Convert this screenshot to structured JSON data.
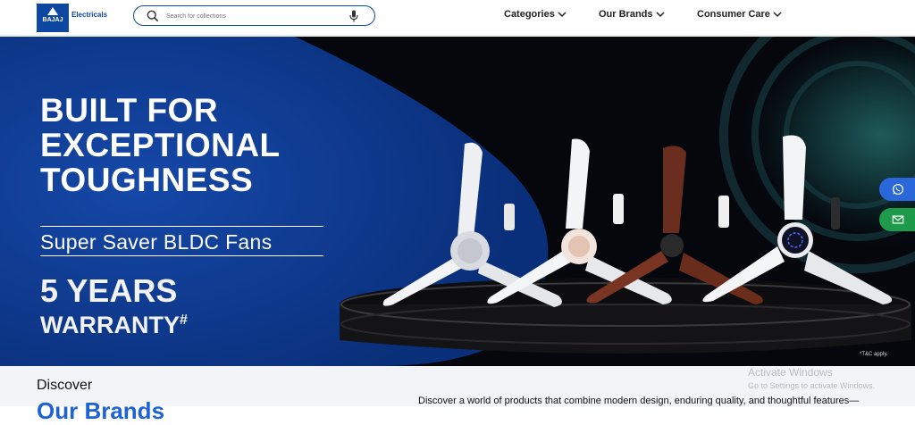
{
  "header": {
    "logo_text": "BAJAJ",
    "logo_sub": "Electricals",
    "search_placeholder": "Search for collections",
    "nav": [
      {
        "label": "Categories"
      },
      {
        "label": "Our Brands"
      },
      {
        "label": "Consumer Care"
      }
    ]
  },
  "hero": {
    "title_lines": [
      "BUILT FOR",
      "EXCEPTIONAL",
      "TOUGHNESS"
    ],
    "subtitle": "Super Saver BLDC Fans",
    "warranty_line1": "5 YEARS",
    "warranty_line2": "WARRANTY",
    "warranty_mark": "#",
    "tnc": "*T&C apply.",
    "colors": {
      "blue": "#0b3c94",
      "accent_blue": "#1e63d6",
      "whatsapp": "#1e63d6",
      "mail": "#1a9a4b"
    }
  },
  "floating": {
    "whatsapp_icon": "whatsapp-icon",
    "mail_icon": "mail-icon"
  },
  "discover": {
    "heading": "Discover",
    "brand_heading": "Our Brands",
    "text": "Discover a world of products that combine modern design, enduring quality, and thoughtful features—"
  },
  "watermark": {
    "line1": "Activate Windows",
    "line2": "Go to Settings to activate Windows."
  }
}
